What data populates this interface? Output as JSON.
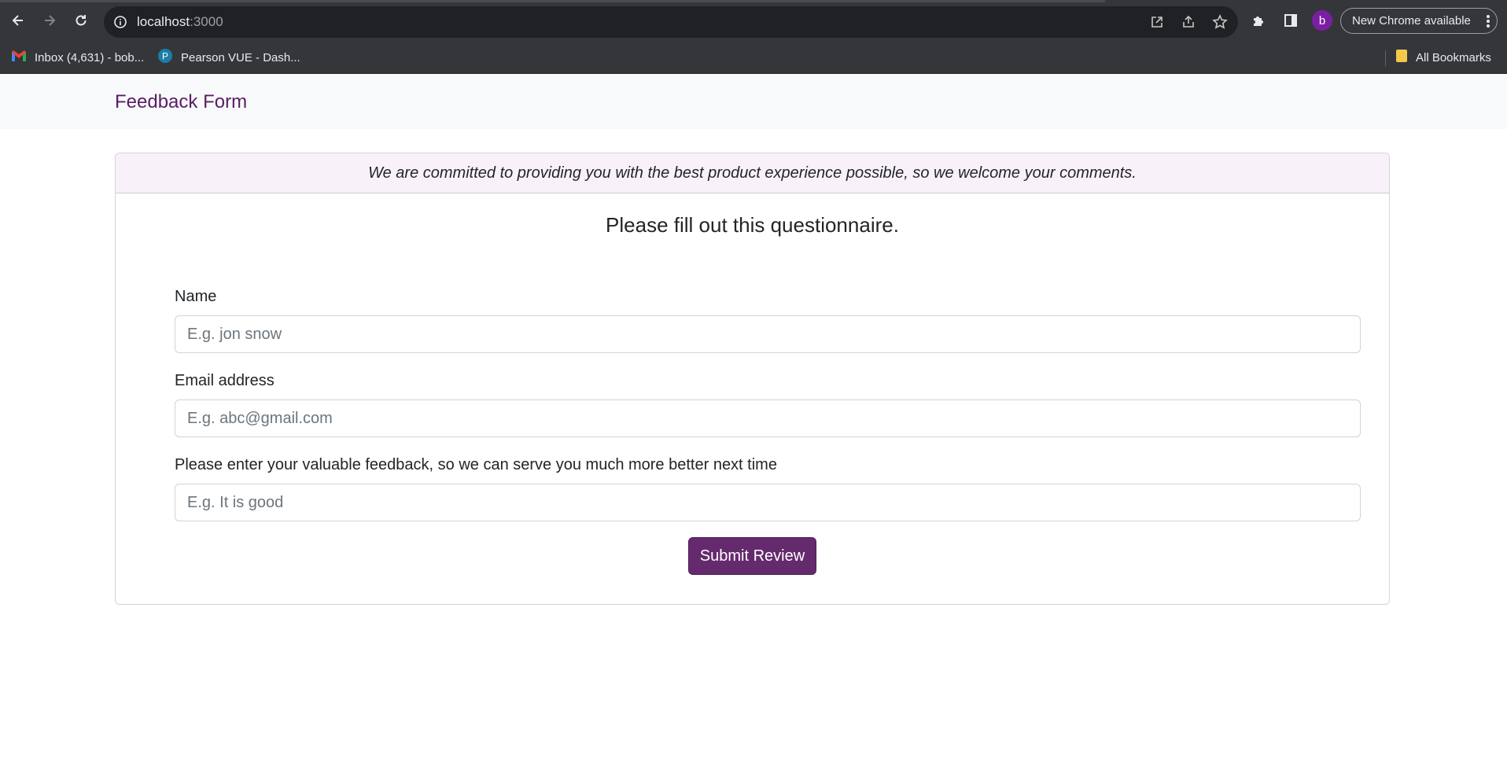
{
  "browser": {
    "url_host": "localhost",
    "url_port": ":3000",
    "profile_initial": "b",
    "update_label": "New Chrome available",
    "bookmarks": [
      {
        "label": "Inbox (4,631) - bob...",
        "icon": "gmail-icon"
      },
      {
        "label": "Pearson VUE - Dash...",
        "icon": "pearson-icon"
      }
    ],
    "all_bookmarks_label": "All Bookmarks"
  },
  "navbar": {
    "brand": "Feedback Form"
  },
  "card": {
    "header": "We are committed to providing you with the best product experience possible, so we welcome your comments.",
    "title": "Please fill out this questionnaire.",
    "fields": {
      "name": {
        "label": "Name",
        "placeholder": "E.g. jon snow",
        "value": ""
      },
      "email": {
        "label": "Email address",
        "placeholder": "E.g. abc@gmail.com",
        "value": ""
      },
      "feedback": {
        "label": "Please enter your valuable feedback, so we can serve you much more better next time",
        "placeholder": "E.g. It is good",
        "value": ""
      }
    },
    "submit_label": "Submit Review"
  },
  "colors": {
    "brand": "#5a1d66",
    "button": "#652a6e",
    "header_bg": "#f9f1fa",
    "chrome_bg": "#35363a"
  }
}
